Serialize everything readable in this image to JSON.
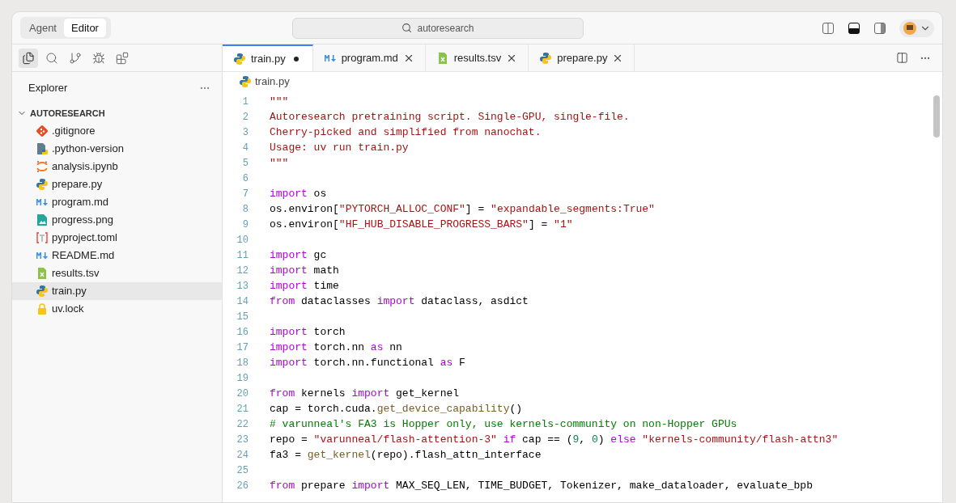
{
  "mode_switch": [
    {
      "label": "Agent",
      "selected": false
    },
    {
      "label": "Editor",
      "selected": true
    }
  ],
  "search": {
    "value": "autoresearch"
  },
  "activity_bar": [
    {
      "kind": "files",
      "selected": true
    },
    {
      "kind": "search",
      "selected": false
    },
    {
      "kind": "branch",
      "selected": false
    },
    {
      "kind": "debug",
      "selected": false
    },
    {
      "kind": "extensions",
      "selected": false
    }
  ],
  "sidebar": {
    "title": "Explorer",
    "folder": {
      "label": "AUTORESEARCH",
      "expanded": true,
      "children": [
        {
          "label": ".gitignore",
          "kind": "git",
          "selected": false
        },
        {
          "label": ".python-version",
          "kind": "pyversion",
          "selected": false
        },
        {
          "label": "analysis.ipynb",
          "kind": "notebook",
          "selected": false
        },
        {
          "label": "prepare.py",
          "kind": "python",
          "selected": false
        },
        {
          "label": "program.md",
          "kind": "markdown",
          "selected": false
        },
        {
          "label": "progress.png",
          "kind": "image",
          "selected": false
        },
        {
          "label": "pyproject.toml",
          "kind": "toml",
          "selected": false
        },
        {
          "label": "README.md",
          "kind": "markdown",
          "selected": false
        },
        {
          "label": "results.tsv",
          "kind": "tsv",
          "selected": false
        },
        {
          "label": "train.py",
          "kind": "python",
          "selected": true
        },
        {
          "label": "uv.lock",
          "kind": "lock",
          "selected": false
        }
      ]
    }
  },
  "tabs": [
    {
      "label": "train.py",
      "kind": "python",
      "selected": true,
      "modified": true
    },
    {
      "label": "program.md",
      "kind": "markdown",
      "selected": false,
      "modified": false
    },
    {
      "label": "results.tsv",
      "kind": "tsv",
      "selected": false,
      "modified": false
    },
    {
      "label": "prepare.py",
      "kind": "python",
      "selected": false,
      "modified": false
    }
  ],
  "breadcrumb": {
    "label": "train.py",
    "kind": "python"
  },
  "code_lines": [
    {
      "n": "1",
      "tokens": [
        {
          "text": "\"\"\"",
          "kind": "str"
        }
      ]
    },
    {
      "n": "2",
      "tokens": [
        {
          "text": "Autoresearch pretraining script. Single-GPU, single-file.",
          "kind": "str"
        }
      ]
    },
    {
      "n": "3",
      "tokens": [
        {
          "text": "Cherry-picked and simplified from nanochat.",
          "kind": "str"
        }
      ]
    },
    {
      "n": "4",
      "tokens": [
        {
          "text": "Usage: uv run train.py",
          "kind": "str"
        }
      ]
    },
    {
      "n": "5",
      "tokens": [
        {
          "text": "\"\"\"",
          "kind": "str"
        }
      ]
    },
    {
      "n": "6"
    },
    {
      "n": "7",
      "tokens": [
        {
          "text": "import",
          "kind": "kw"
        },
        {
          "text": " os",
          "kind": "plain"
        }
      ]
    },
    {
      "n": "8",
      "tokens": [
        {
          "text": "os.environ[",
          "kind": "plain"
        },
        {
          "text": "\"PYTORCH_ALLOC_CONF\"",
          "kind": "str"
        },
        {
          "text": "] = ",
          "kind": "plain"
        },
        {
          "text": "\"expandable_segments:True\"",
          "kind": "str"
        }
      ]
    },
    {
      "n": "9",
      "tokens": [
        {
          "text": "os.environ[",
          "kind": "plain"
        },
        {
          "text": "\"HF_HUB_DISABLE_PROGRESS_BARS\"",
          "kind": "str"
        },
        {
          "text": "] = ",
          "kind": "plain"
        },
        {
          "text": "\"1\"",
          "kind": "str"
        }
      ]
    },
    {
      "n": "10"
    },
    {
      "n": "11",
      "tokens": [
        {
          "text": "import",
          "kind": "kw"
        },
        {
          "text": " gc",
          "kind": "plain"
        }
      ]
    },
    {
      "n": "12",
      "tokens": [
        {
          "text": "import",
          "kind": "kw"
        },
        {
          "text": " math",
          "kind": "plain"
        }
      ]
    },
    {
      "n": "13",
      "tokens": [
        {
          "text": "import",
          "kind": "kw"
        },
        {
          "text": " time",
          "kind": "plain"
        }
      ]
    },
    {
      "n": "14",
      "tokens": [
        {
          "text": "from",
          "kind": "kw"
        },
        {
          "text": " dataclasses ",
          "kind": "plain"
        },
        {
          "text": "import",
          "kind": "kw"
        },
        {
          "text": " dataclass, asdict",
          "kind": "plain"
        }
      ]
    },
    {
      "n": "15"
    },
    {
      "n": "16",
      "tokens": [
        {
          "text": "import",
          "kind": "kw"
        },
        {
          "text": " torch",
          "kind": "plain"
        }
      ]
    },
    {
      "n": "17",
      "tokens": [
        {
          "text": "import",
          "kind": "kw"
        },
        {
          "text": " torch.nn ",
          "kind": "plain"
        },
        {
          "text": "as",
          "kind": "kw"
        },
        {
          "text": " nn",
          "kind": "plain"
        }
      ]
    },
    {
      "n": "18",
      "tokens": [
        {
          "text": "import",
          "kind": "kw"
        },
        {
          "text": " torch.nn.functional ",
          "kind": "plain"
        },
        {
          "text": "as",
          "kind": "kw"
        },
        {
          "text": " F",
          "kind": "plain"
        }
      ]
    },
    {
      "n": "19"
    },
    {
      "n": "20",
      "tokens": [
        {
          "text": "from",
          "kind": "kw"
        },
        {
          "text": " kernels ",
          "kind": "plain"
        },
        {
          "text": "import",
          "kind": "kw"
        },
        {
          "text": " get_kernel",
          "kind": "plain"
        }
      ]
    },
    {
      "n": "21",
      "tokens": [
        {
          "text": "cap = torch.cuda.",
          "kind": "plain"
        },
        {
          "text": "get_device_capability",
          "kind": "fn"
        },
        {
          "text": "()",
          "kind": "plain"
        }
      ]
    },
    {
      "n": "22",
      "tokens": [
        {
          "text": "# varunneal's FA3 is Hopper only, use kernels-community on non-Hopper GPUs",
          "kind": "com"
        }
      ]
    },
    {
      "n": "23",
      "tokens": [
        {
          "text": "repo = ",
          "kind": "plain"
        },
        {
          "text": "\"varunneal/flash-attention-3\"",
          "kind": "str"
        },
        {
          "text": " if",
          "kind": "kw"
        },
        {
          "text": " cap == (",
          "kind": "plain"
        },
        {
          "text": "9",
          "kind": "num"
        },
        {
          "text": ", ",
          "kind": "plain"
        },
        {
          "text": "0",
          "kind": "num"
        },
        {
          "text": ") ",
          "kind": "plain"
        },
        {
          "text": "else ",
          "kind": "kw"
        },
        {
          "text": "\"kernels-community/flash-attn3\"",
          "kind": "str"
        }
      ]
    },
    {
      "n": "24",
      "tokens": [
        {
          "text": "fa3 = ",
          "kind": "plain"
        },
        {
          "text": "get_kernel",
          "kind": "fn"
        },
        {
          "text": "(repo).flash_attn_interface",
          "kind": "plain"
        }
      ]
    },
    {
      "n": "25"
    },
    {
      "n": "26",
      "tokens": [
        {
          "text": "from",
          "kind": "kw"
        },
        {
          "text": " prepare ",
          "kind": "plain"
        },
        {
          "text": "import",
          "kind": "kw"
        },
        {
          "text": " MAX_SEQ_LEN, TIME_BUDGET, Tokenizer, make_dataloader, evaluate_bpb",
          "kind": "plain"
        }
      ]
    }
  ]
}
